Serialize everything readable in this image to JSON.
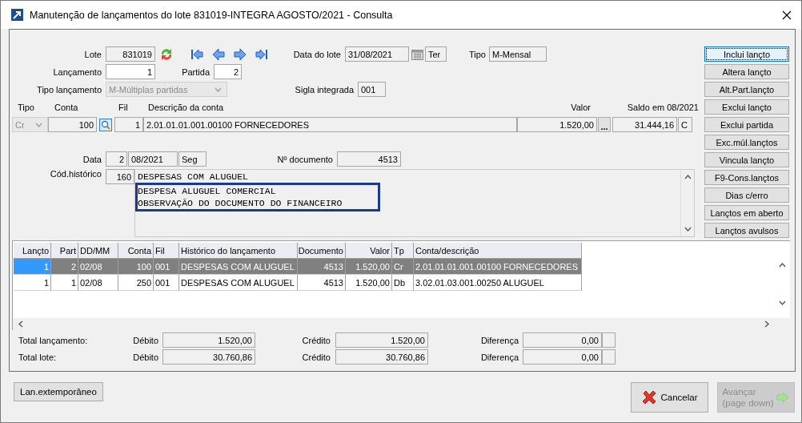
{
  "window": {
    "title": "Manutenção de lançamentos do lote 831019-INTEGRA AGOSTO/2021 - Consulta"
  },
  "lote": {
    "label": "Lote",
    "value": "831019"
  },
  "data_lote": {
    "label": "Data do lote",
    "value": "31/08/2021",
    "weekday": "Ter"
  },
  "tipo": {
    "label": "Tipo",
    "value": "M-Mensal"
  },
  "lancamento": {
    "label": "Lançamento",
    "value": "1"
  },
  "partida": {
    "label": "Partida",
    "value": "2"
  },
  "tipo_lancamento": {
    "label": "Tipo lançamento",
    "value": "M-Múltiplas partidas",
    "disabled": true
  },
  "sigla_integrada": {
    "label": "Sigla integrada",
    "value": "001"
  },
  "conta_headers": [
    "Tipo",
    "Conta",
    "Fil",
    "Descrição da conta",
    "Valor",
    "Saldo em 08/2021"
  ],
  "conta": {
    "tipo": "Cr",
    "conta": "100",
    "fil": "1",
    "descricao": "2.01.01.01.001.00100 FORNECEDORES",
    "valor": "1.520,00",
    "more": "...",
    "saldo": "31.444,16",
    "saldo_dc": "C"
  },
  "data": {
    "label": "Data",
    "day": "2",
    "month": "08/2021",
    "weekday": "Seg"
  },
  "documento": {
    "label": "Nº documento",
    "value": "4513"
  },
  "historico": {
    "label": "Cód.histórico",
    "code": "160",
    "lines": [
      {
        "text": "DESPESAS COM ALUGUEL",
        "highlighted": false
      },
      {
        "text": "DESPESA ALUGUEL COMERCIAL",
        "highlighted": true
      },
      {
        "text": "OBSERVAÇÃO DO DOCUMENTO DO FINANCEIRO",
        "highlighted": true
      }
    ]
  },
  "side_buttons": [
    {
      "label": "Inclui lançto",
      "focused": true
    },
    {
      "label": "Altera lançto",
      "focused": false
    },
    {
      "label": "Alt.Part.lançto",
      "focused": false
    },
    {
      "label": "Exclui lançto",
      "focused": false
    },
    {
      "label": "Exclui partida",
      "focused": false
    },
    {
      "label": "Exc.múl.lançtos",
      "focused": false
    },
    {
      "label": "Vincula lançto",
      "focused": false
    },
    {
      "label": "F9-Cons.lançtos",
      "focused": false
    },
    {
      "label": "Dias c/erro",
      "focused": false
    },
    {
      "label": "Lançtos em aberto",
      "focused": false
    },
    {
      "label": "Lançtos avulsos",
      "focused": false
    }
  ],
  "table": {
    "columns": [
      "Lançto",
      "Part",
      "DD/MM",
      "Conta",
      "Fil",
      "Histórico do lançamento",
      "Documento",
      "Valor",
      "Tp",
      "Conta/descrição"
    ],
    "rows": [
      {
        "selected": true,
        "cells": [
          "1",
          "2",
          "02/08",
          "100",
          "001",
          "DESPESAS COM ALUGUEL",
          "4513",
          "1.520,00",
          "Cr",
          "2.01.01.01.001.00100 FORNECEDORES"
        ]
      },
      {
        "selected": false,
        "cells": [
          "1",
          "1",
          "02/08",
          "250",
          "001",
          "DESPESAS COM ALUGUEL",
          "4513",
          "1.520,00",
          "Db",
          "3.02.01.03.001.00250 ALUGUEL"
        ]
      }
    ]
  },
  "totals": [
    {
      "label": "Total lançamento:",
      "debit_label": "Débito",
      "debit": "1.520,00",
      "credit_label": "Crédito",
      "credit": "1.520,00",
      "diff_label": "Diferença",
      "diff": "0,00"
    },
    {
      "label": "Total lote:",
      "debit_label": "Débito",
      "debit": "30.760,86",
      "credit_label": "Crédito",
      "credit": "30.760,86",
      "diff_label": "Diferença",
      "diff": "0,00"
    }
  ],
  "footer": {
    "left_button": "Lan.extemporâneo",
    "buttons": [
      {
        "label": "Cancelar",
        "kind": "cancel",
        "disabled": false
      },
      {
        "label": "Avançar\n(page down)",
        "kind": "next",
        "disabled": true
      }
    ]
  }
}
